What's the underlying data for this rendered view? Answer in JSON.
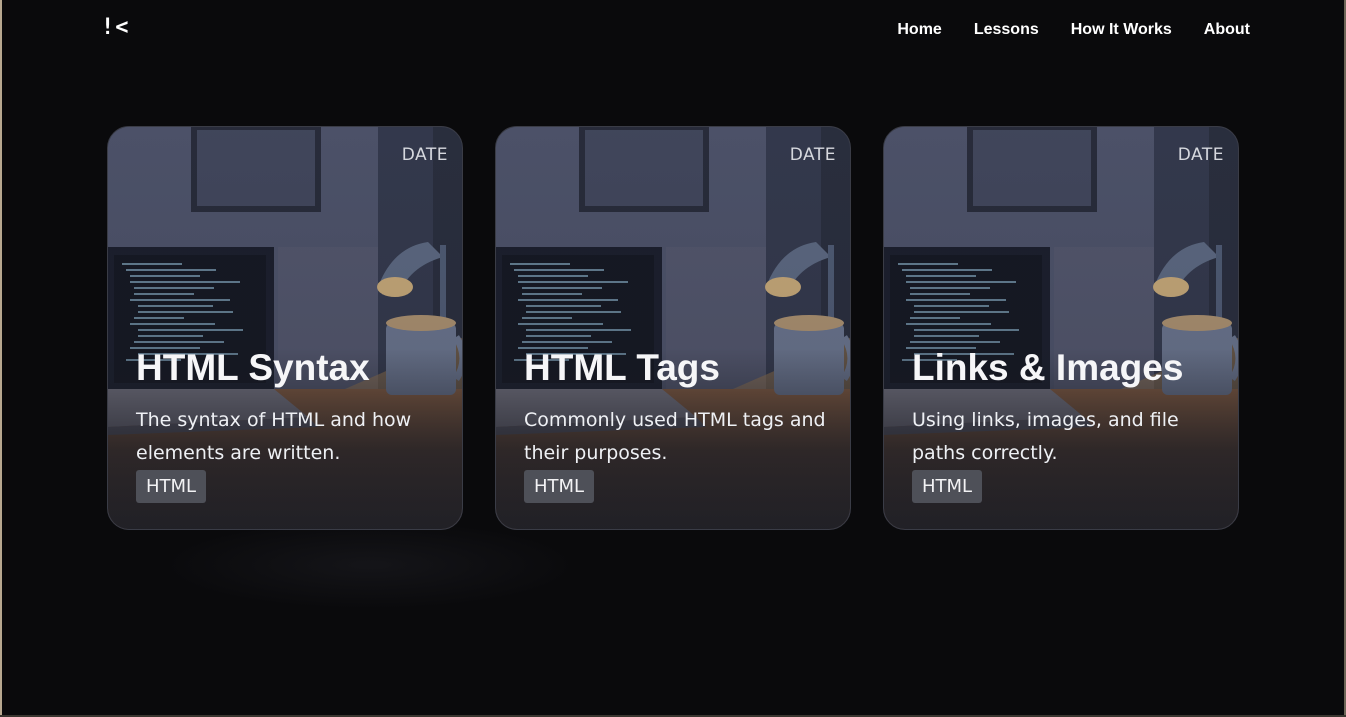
{
  "header": {
    "logo": "!<",
    "nav": [
      {
        "label": "Home"
      },
      {
        "label": "Lessons"
      },
      {
        "label": "How It Works"
      },
      {
        "label": "About"
      }
    ]
  },
  "cards": [
    {
      "date": "DATE",
      "title": "HTML Syntax",
      "description": "The syntax of HTML and how elements are written.",
      "tag": "HTML"
    },
    {
      "date": "DATE",
      "title": "HTML Tags",
      "description": "Commonly used HTML tags and their purposes.",
      "tag": "HTML"
    },
    {
      "date": "DATE",
      "title": "Links & Images",
      "description": "Using links, images, and file paths correctly.",
      "tag": "HTML"
    }
  ],
  "colors": {
    "background": "#0a0a0c",
    "card_border": "#3a3c46",
    "tag_background": "#4e5058",
    "text": "#ffffff"
  },
  "icons": {
    "card_image": "desk-laptop-lamp-mug-illustration"
  }
}
